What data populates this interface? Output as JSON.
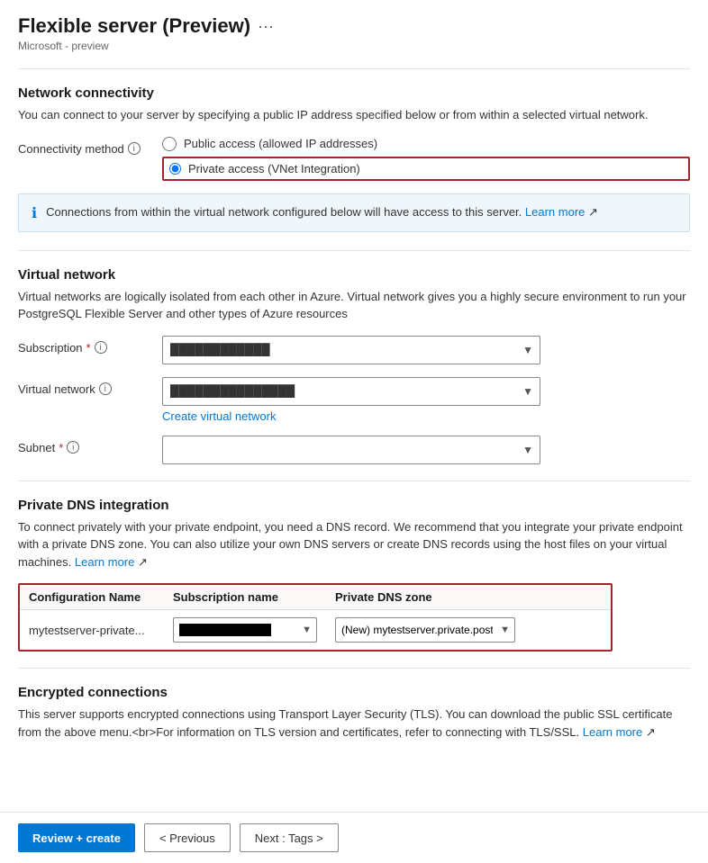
{
  "header": {
    "title": "Flexible server (Preview)",
    "subtitle": "Microsoft - preview",
    "ellipsis": "···"
  },
  "networkSection": {
    "title": "Network connectivity",
    "description": "You can connect to your server by specifying a public IP address specified below or from within a selected virtual network.",
    "connectivityLabel": "Connectivity method",
    "infoTooltip": "i",
    "options": [
      {
        "label": "Public access (allowed IP addresses)",
        "value": "public"
      },
      {
        "label": "Private access (VNet Integration)",
        "value": "private"
      }
    ],
    "selectedOption": "private",
    "infoBanner": "Connections from within the virtual network configured below will have access to this server.",
    "infoBannerLink": "Learn more",
    "infoBannerIcon": "ℹ"
  },
  "virtualNetworkSection": {
    "title": "Virtual network",
    "description": "Virtual networks are logically isolated from each other in Azure. Virtual network gives you a highly secure environment to run your PostgreSQL Flexible Server and other types of Azure resources",
    "subscriptionLabel": "Subscription",
    "subscriptionRequired": "*",
    "subscriptionTooltip": "i",
    "subscriptionValue": "████████████",
    "virtualNetworkLabel": "Virtual network",
    "virtualNetworkTooltip": "i",
    "virtualNetworkValue": "███████████████",
    "createVirtualNetworkLink": "Create virtual network",
    "subnetLabel": "Subnet",
    "subnetRequired": "*",
    "subnetTooltip": "i",
    "subnetValue": ""
  },
  "dnsSection": {
    "title": "Private DNS integration",
    "description": "To connect privately with your private endpoint, you need a DNS record. We recommend that you integrate your private endpoint with a private DNS zone. You can also utilize your own DNS servers or create DNS records using the host files on your virtual machines.",
    "dnsLink": "Learn more",
    "tableHeaders": {
      "configName": "Configuration Name",
      "subscriptionName": "Subscription name",
      "privateDnsZone": "Private DNS zone"
    },
    "tableRow": {
      "configName": "mytestserver-private...",
      "subscriptionValue": "████████████",
      "dnsZoneValue": "(New) mytestserver.private.postgres.datab..."
    }
  },
  "encryptedSection": {
    "title": "Encrypted connections",
    "description": "This server supports encrypted connections using Transport Layer Security (TLS). You can download the public SSL certificate from the above menu.<br>For information on TLS version and certificates, refer to connecting with TLS/SSL.",
    "learnMoreLink": "Learn more"
  },
  "footer": {
    "reviewCreateLabel": "Review + create",
    "previousLabel": "< Previous",
    "nextLabel": "Next : Tags >"
  }
}
